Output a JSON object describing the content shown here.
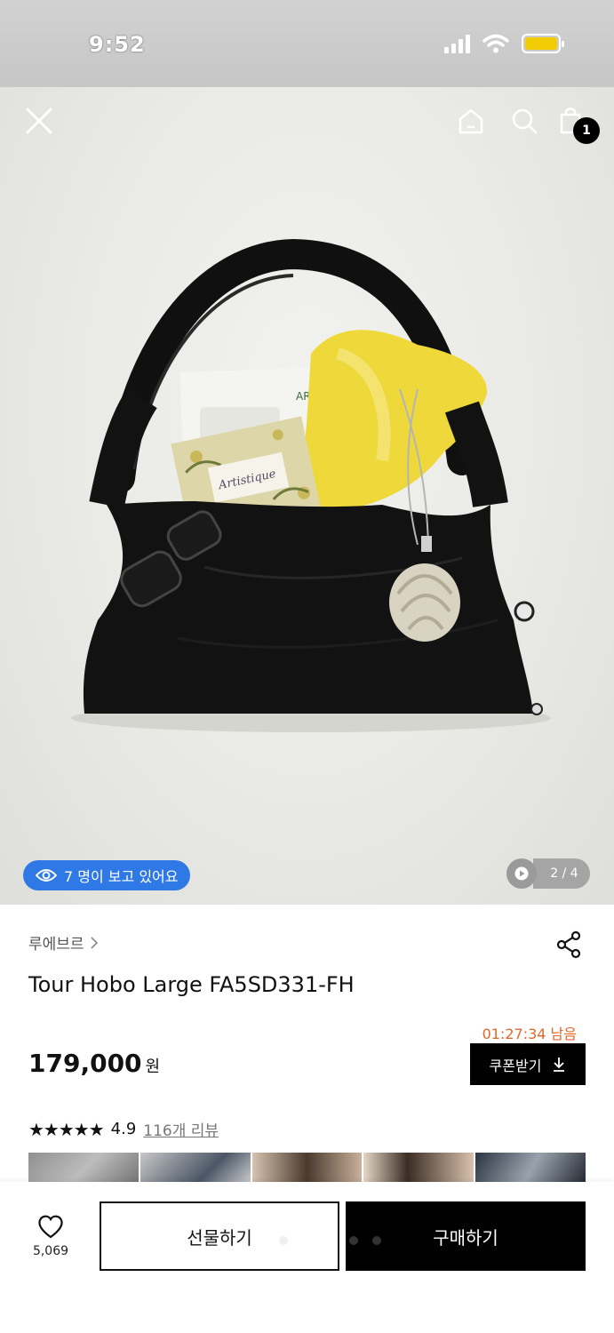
{
  "status_bar": {
    "time": "9:52"
  },
  "hero": {
    "cart_count": "1",
    "viewer_text": "7 명이 보고 있어요",
    "page_indicator": "2 / 4",
    "photo_text": {
      "book": "Artistique",
      "card": "ARO"
    },
    "colors": {
      "viewer_badge": "#2f79e6"
    }
  },
  "product": {
    "brand": "루에브르",
    "title": "Tour Hobo Large FA5SD331-FH",
    "countdown": "01:27:34 남음",
    "price": "179,000",
    "currency": "원",
    "coupon_label": "쿠폰받기",
    "rating": "4.9",
    "review_link": "116개 리뷰",
    "colors": {
      "countdown": "#e2672b"
    }
  },
  "bottom_bar": {
    "like_count": "5,069",
    "gift_label": "선물하기",
    "buy_label": "구매하기"
  }
}
